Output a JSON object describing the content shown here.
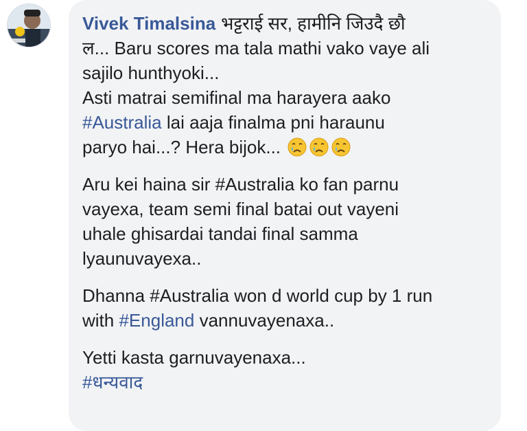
{
  "comment": {
    "author": "Vivek Timalsina",
    "line1_text": "भट्टराई सर, हामीनि जिउदै छौ",
    "line2": "ल... Baru scores ma tala mathi vako vaye ali",
    "line3": "sajilo hunthyoki...",
    "line4": "Asti matrai semifinal ma harayera aako",
    "line5_tag": "#Australia",
    "line5_rest": " lai aaja finalma pni haraunu",
    "line6": "paryo hai...? Hera bijok...",
    "emoji_icon": "crying-face",
    "para2": [
      "Aru kei haina sir #Australia ko fan parnu",
      "vayexa, team semi final batai out vayeni",
      "uhale ghisardai tandai final samma",
      "lyaunuvayexa.."
    ],
    "para3_line1": "Dhanna #Australia won d world cup by 1 run",
    "para3_line2_pre": "with ",
    "para3_line2_tag": "#England",
    "para3_line2_rest": " vannuvayenaxa..",
    "para4_line1": "Yetti kasta garnuvayenaxa...",
    "para4_tag": "#धन्यवाद"
  },
  "colors": {
    "link": "#385898",
    "bubble": "#f2f3f5",
    "text": "#1c1e21"
  }
}
